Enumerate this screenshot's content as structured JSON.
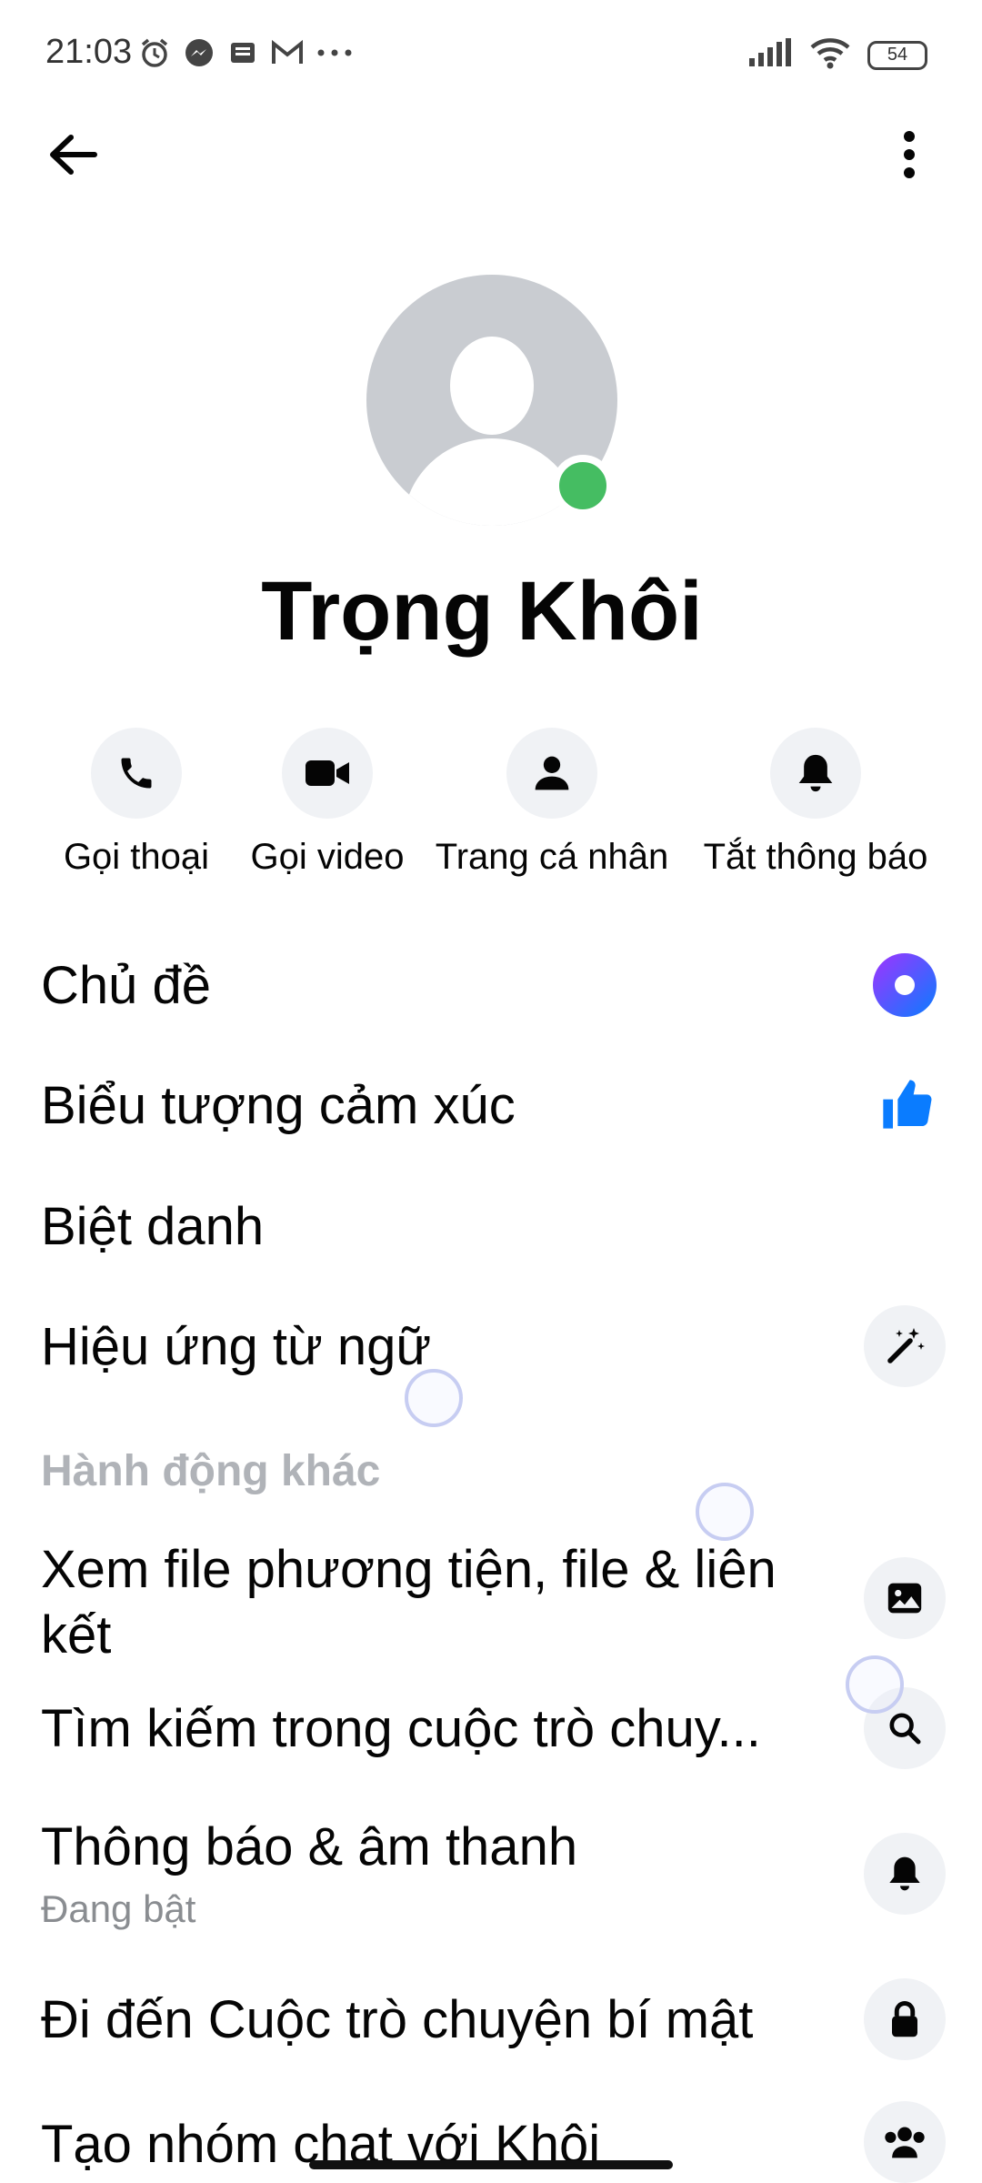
{
  "status_bar": {
    "time": "21:03",
    "battery": "54"
  },
  "profile": {
    "name": "Trọng Khôi",
    "online_color": "#45bd62"
  },
  "actions": [
    {
      "label": "Gọi thoại",
      "icon": "phone-icon"
    },
    {
      "label": "Gọi video",
      "icon": "video-camera-icon"
    },
    {
      "label": "Trang cá nhân",
      "icon": "person-icon"
    },
    {
      "label": "Tắt thông báo",
      "icon": "bell-icon"
    }
  ],
  "settings": {
    "theme": "Chủ đề",
    "emoji": "Biểu tượng cảm xúc",
    "nicknames": "Biệt danh",
    "word_effects": "Hiệu ứng từ ngữ"
  },
  "more_actions": {
    "header": "Hành động khác",
    "view_media": "Xem file phương tiện, file & liên kết",
    "search": "Tìm kiếm trong cuộc trò chuy...",
    "notifications": "Thông báo & âm thanh",
    "notifications_status": "Đang bật",
    "secret_chat": "Đi đến Cuộc trò chuyện bí mật",
    "create_group": "Tạo nhóm chat với Khôi"
  },
  "colors": {
    "accent": "#0a7cff",
    "theme_gradient_start": "#a033ff",
    "theme_gradient_end": "#0a7cff"
  }
}
